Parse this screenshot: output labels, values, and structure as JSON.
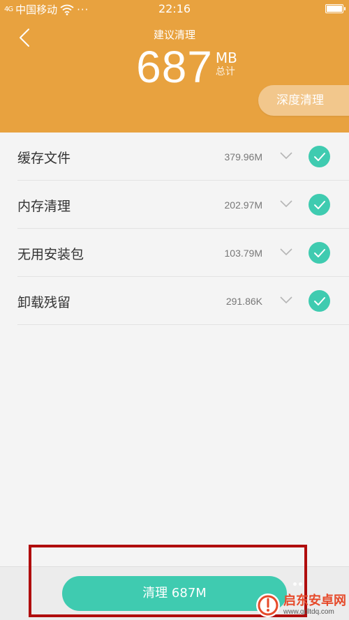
{
  "status_bar": {
    "signal": "4G",
    "carrier": "中国移动",
    "more": "···",
    "time": "22:16"
  },
  "header": {
    "title": "建议清理",
    "total_value": "687",
    "total_unit": "MB",
    "total_label": "总计",
    "deep_clean_label": "深度清理",
    "background_color": "#e8a23f"
  },
  "items": [
    {
      "label": "缓存文件",
      "size": "379.96M",
      "checked": true
    },
    {
      "label": "内存清理",
      "size": "202.97M",
      "checked": true
    },
    {
      "label": "无用安装包",
      "size": "103.79M",
      "checked": true
    },
    {
      "label": "卸载残留",
      "size": "291.86K",
      "checked": true
    }
  ],
  "bottom": {
    "clean_label": "清理 687M",
    "accent_color": "#3fcbb0"
  },
  "watermark": {
    "name": "启东安卓网",
    "url": "www.qdltdq.com"
  }
}
